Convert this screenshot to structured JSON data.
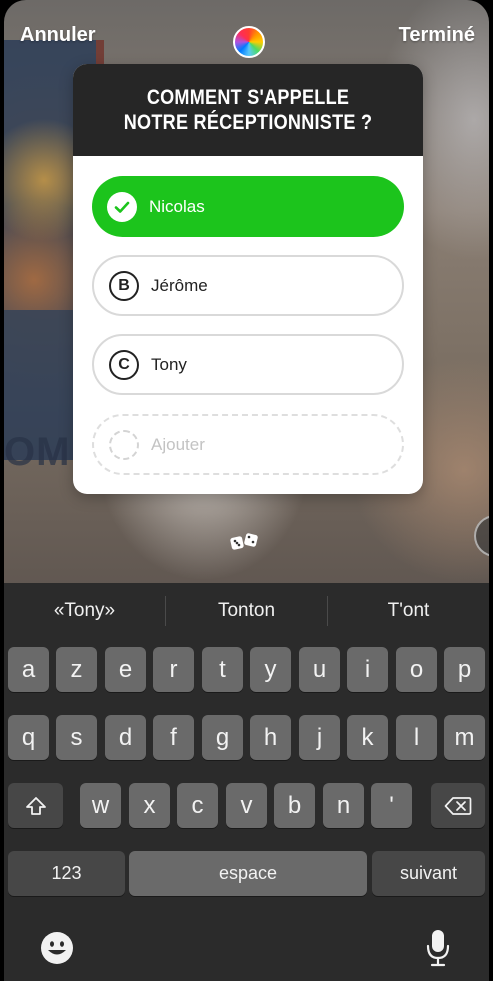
{
  "topbar": {
    "cancel_label": "Annuler",
    "done_label": "Terminé"
  },
  "quiz": {
    "question": "COMMENT S'APPELLE NOTRE RÉCEPTIONNISTE ?",
    "options": [
      {
        "letter": "✓",
        "label": "Nicolas",
        "correct": true
      },
      {
        "letter": "B",
        "label": "Jérôme",
        "correct": false
      },
      {
        "letter": "C",
        "label": "Tony",
        "correct": false
      }
    ],
    "add_option_placeholder": "Ajouter",
    "correct_color": "#1cc41c"
  },
  "background": {
    "frame_text": "OMI"
  },
  "keyboard": {
    "suggestions": [
      "«Tony»",
      "Tonton",
      "T'ont"
    ],
    "row1": [
      "a",
      "z",
      "e",
      "r",
      "t",
      "y",
      "u",
      "i",
      "o",
      "p"
    ],
    "row2": [
      "q",
      "s",
      "d",
      "f",
      "g",
      "h",
      "j",
      "k",
      "l",
      "m"
    ],
    "row3": [
      "w",
      "x",
      "c",
      "v",
      "b",
      "n",
      "'"
    ],
    "numbers_label": "123",
    "space_label": "espace",
    "next_label": "suivant",
    "shift_icon": "shift-icon",
    "delete_icon": "delete-icon",
    "emoji_icon": "emoji-icon",
    "mic_icon": "microphone-icon"
  }
}
